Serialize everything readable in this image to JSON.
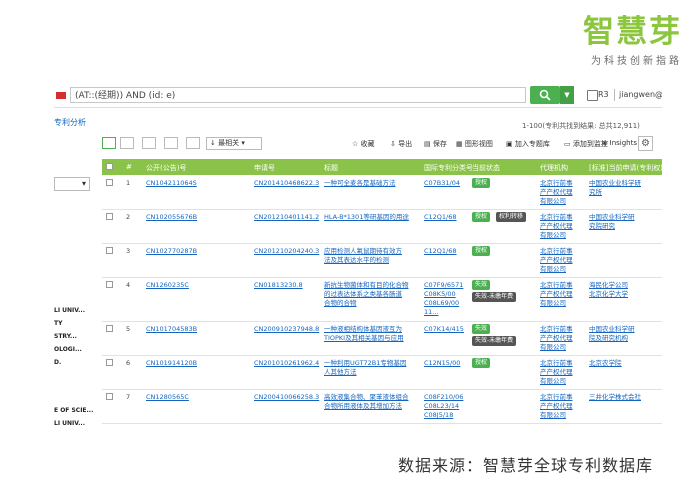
{
  "brand": {
    "name": "智慧芽",
    "slogan": "为科技创新指路"
  },
  "search": {
    "query": "(AT::(经期)) AND (id: e)"
  },
  "user": {
    "count": "R3",
    "email": "jiangwen@patsnap.cu"
  },
  "left_panel": {
    "title": "专利分析",
    "lines": [
      "LI UNIV...",
      "TY",
      "STRY...",
      "OLOGI...",
      "D.",
      "E OF SCIE...",
      "LI UNIV..."
    ]
  },
  "toolbar": {
    "sort_label": "最相关",
    "actions": [
      "收藏",
      "导出",
      "保存",
      "图形视图",
      "加入专题库",
      "添加到监控",
      "Insights"
    ]
  },
  "result_count": "1-100(专利共找到结果: 总共12,911)",
  "columns": [
    "#",
    "公开(公告)号",
    "申请号",
    "标题",
    "国际专利分类号",
    "当前状态",
    "代理机构",
    "[标准]当前申请(专利权)人"
  ],
  "rows": [
    {
      "num": "1",
      "pub": "CN104211064S",
      "app": "CN201410468622.3",
      "title": [
        "一种可全麦各是基础方法"
      ],
      "ipc": [
        "C07B31/04"
      ],
      "status": [
        "授权"
      ],
      "agency": [
        "北京行前事",
        "产产权代理",
        "有限公司"
      ],
      "assignee": [
        "中国农业业科学研",
        "究所"
      ]
    },
    {
      "num": "2",
      "pub": "CN102055676B",
      "app": "CN201210401141.2",
      "title": [
        "HLA-B*1301等研基因的用途"
      ],
      "ipc": [
        "C12Q1/68"
      ],
      "status": [
        "授权",
        "权利转移"
      ],
      "agency": [
        "北京行前事",
        "产产权代理",
        "有限公司"
      ],
      "assignee": [
        "中国农业科学研",
        "究院研究"
      ]
    },
    {
      "num": "3",
      "pub": "CN102770287B",
      "app": "CN201210204240.3",
      "title": [
        "应用检测人氧鼠期待有效方",
        "法及其表达水平的检测"
      ],
      "ipc": [
        "C12Q1/68"
      ],
      "status": [
        "授权"
      ],
      "agency": [
        "北京行前事",
        "产产权代理",
        "有限公司"
      ],
      "assignee": []
    },
    {
      "num": "4",
      "pub": "CN1260235C",
      "app": "CN01813230.8",
      "title": [
        "新抗生物菌体和有目的化合物",
        "的过表达体系之类基各肠道",
        "合物的合物"
      ],
      "ipc": [
        "C07F9/6571",
        "C08K5/00",
        "C08L69/00",
        "11..."
      ],
      "status": [
        "失效",
        "失效-未缴年费"
      ],
      "agency": [
        "北京行前事",
        "产产权代理",
        "有限公司"
      ],
      "assignee": [
        "海民化学公司",
        "北京化学大学"
      ]
    },
    {
      "num": "5",
      "pub": "CN101704583B",
      "app": "CN200910237948.8",
      "title": [
        "一种液相结构体基因液互为",
        "TIOPKI及其相关基因与应用"
      ],
      "ipc": [
        "C07K14/415"
      ],
      "status": [
        "失效",
        "失效-未缴年费"
      ],
      "agency": [
        "北京行前事",
        "产产权代理",
        "有限公司"
      ],
      "assignee": [
        "中国农业科学研",
        "院及研究机构"
      ]
    },
    {
      "num": "6",
      "pub": "CN101914120B",
      "app": "CN201010261962.4",
      "title": [
        "一种利用UGT72B1专物基因",
        "人其他方法"
      ],
      "ipc": [
        "C12N15/00"
      ],
      "status": [
        "授权"
      ],
      "agency": [
        "北京行前事",
        "产产权代理",
        "有限公司"
      ],
      "assignee": [
        "北京农学院"
      ]
    },
    {
      "num": "7",
      "pub": "CN1280565C",
      "app": "CN200410066258.3",
      "title": [
        "高效液集合物、聚苯液体组合",
        "合物所用液体及其增加方法"
      ],
      "ipc": [
        "C08F210/06",
        "C08L23/14",
        "C08J5/18"
      ],
      "status": [],
      "agency": [
        "北京行前事",
        "产产权代理",
        "有限公司"
      ],
      "assignee": [
        "三井化学株式会社"
      ]
    }
  ],
  "source_note": "数据来源：智慧芽全球专利数据库"
}
